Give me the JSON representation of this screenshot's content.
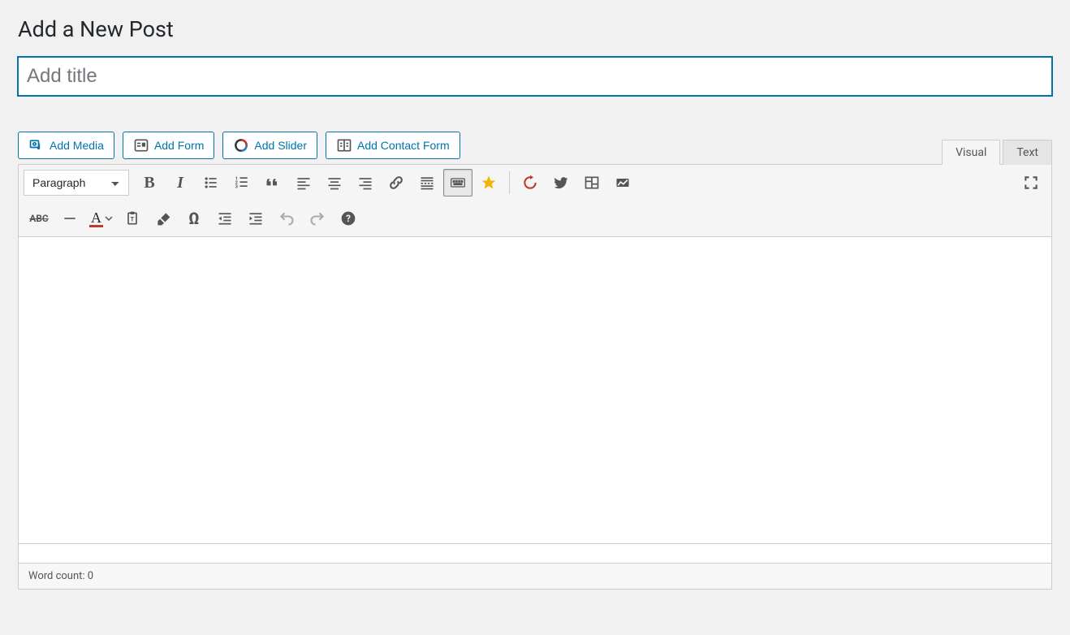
{
  "page": {
    "heading": "Add a New Post"
  },
  "title_field": {
    "placeholder": "Add title",
    "value": ""
  },
  "media_buttons": {
    "add_media": "Add Media",
    "add_form": "Add Form",
    "add_slider": "Add Slider",
    "add_contact_form": "Add Contact Form"
  },
  "tabs": {
    "visual": "Visual",
    "text": "Text",
    "active": "visual"
  },
  "format_select": {
    "value": "Paragraph"
  },
  "status": {
    "word_count_label": "Word count: ",
    "word_count_value": "0"
  },
  "toolbar": {
    "icons_row1": [
      "bold",
      "italic",
      "bullet-list",
      "number-list",
      "blockquote",
      "align-left",
      "align-center",
      "align-right",
      "link",
      "read-more",
      "toolbar-toggle",
      "star",
      "refresh",
      "twitter",
      "form",
      "chart"
    ],
    "icons_row2": [
      "strikethrough",
      "hr",
      "text-color",
      "paste-text",
      "clear-format",
      "special-char",
      "outdent",
      "indent",
      "undo",
      "redo",
      "help"
    ],
    "fullscreen": "fullscreen"
  }
}
